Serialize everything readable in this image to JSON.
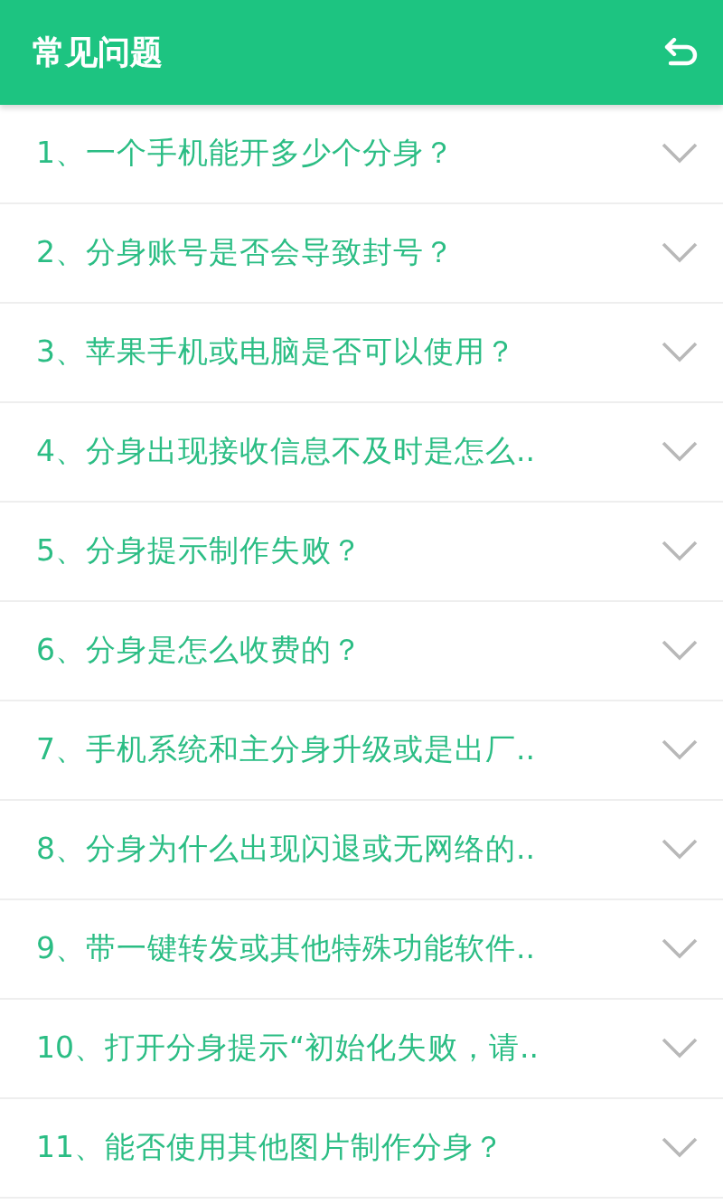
{
  "header": {
    "title": "常见问题"
  },
  "questions": [
    {
      "text": "1、一个手机能开多少个分身？",
      "expanded": false
    },
    {
      "text": "2、分身账号是否会导致封号？",
      "expanded": false
    },
    {
      "text": "3、苹果手机或电脑是否可以使用？",
      "expanded": false
    },
    {
      "text": "4、分身出现接收信息不及时是怎么..",
      "expanded": false
    },
    {
      "text": "5、分身提示制作失败？",
      "expanded": false
    },
    {
      "text": "6、分身是怎么收费的？",
      "expanded": false
    },
    {
      "text": "7、手机系统和主分身升级或是出厂..",
      "expanded": false
    },
    {
      "text": "8、分身为什么出现闪退或无网络的..",
      "expanded": false
    },
    {
      "text": "9、带一键转发或其他特殊功能软件..",
      "expanded": false
    },
    {
      "text": "10、打开分身提示“初始化失败，请..",
      "expanded": false
    },
    {
      "text": "11、能否使用其他图片制作分身？",
      "expanded": false
    }
  ]
}
